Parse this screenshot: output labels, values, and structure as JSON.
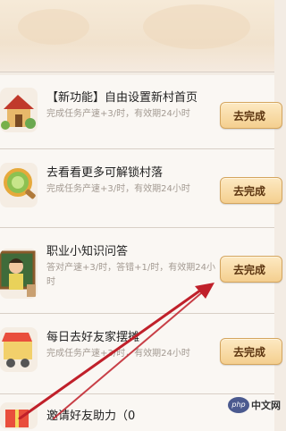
{
  "tasks": [
    {
      "title": "【新功能】自由设置新村首页",
      "desc": "完成任务产速+3/时，有效期24小时",
      "button": "去完成",
      "icon": "village-house-icon"
    },
    {
      "title": "去看看更多可解锁村落",
      "desc": "完成任务产速+3/时，有效期24小时",
      "button": "去完成",
      "icon": "magnifier-icon"
    },
    {
      "title": "职业小知识问答",
      "desc": "答对产速+3/时，答错+1/时，有效期24小时",
      "button": "去完成",
      "icon": "teacher-blackboard-icon"
    },
    {
      "title": "每日去好友家摆摊",
      "desc": "完成任务产速+3/时，有效期24小时",
      "button": "去完成",
      "icon": "food-cart-icon"
    },
    {
      "title": "邀请好友助力（0",
      "icon": "gift-icon"
    }
  ],
  "watermark": {
    "logo": "php",
    "text": "中文网"
  },
  "colors": {
    "arrow": "#c0202a",
    "button_bg": "#f4cf8f",
    "button_text": "#5c3510"
  }
}
